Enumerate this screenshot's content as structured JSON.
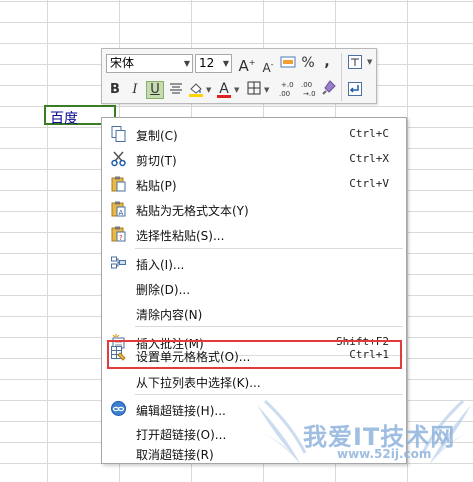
{
  "cell": {
    "value": "百度"
  },
  "mini_toolbar": {
    "font_name": "宋体",
    "font_size": "12",
    "grow_font": "A",
    "shrink_font": "A",
    "percent": "%",
    "comma": "،",
    "bold": "B",
    "italic": "I",
    "underline": "U",
    "font_color_letter": "A",
    "decimal_increase": ".0 .00",
    "decimal_decrease": ".00 .0",
    "font_color": "#e02020",
    "fill_color": "#ffd400"
  },
  "context_menu": {
    "items": [
      {
        "label": "复制(C)",
        "shortcut": "Ctrl+C",
        "icon": "copy-icon"
      },
      {
        "label": "剪切(T)",
        "shortcut": "Ctrl+X",
        "icon": "scissors-icon"
      },
      {
        "label": "粘贴(P)",
        "shortcut": "Ctrl+V",
        "icon": "paste-icon"
      },
      {
        "label": "粘贴为无格式文本(Y)",
        "shortcut": "",
        "icon": "paste-text-icon"
      },
      {
        "label": "选择性粘贴(S)...",
        "shortcut": "",
        "icon": "paste-special-icon"
      },
      {
        "label": "插入(I)...",
        "shortcut": "",
        "icon": "insert-icon"
      },
      {
        "label": "删除(D)...",
        "shortcut": "",
        "icon": ""
      },
      {
        "label": "清除内容(N)",
        "shortcut": "",
        "icon": ""
      },
      {
        "label": "插入批注(M)",
        "shortcut": "Shift+F2",
        "icon": "comment-icon"
      },
      {
        "label": "设置单元格格式(O)...",
        "shortcut": "Ctrl+1",
        "icon": "format-cells-icon"
      },
      {
        "label": "从下拉列表中选择(K)...",
        "shortcut": "",
        "icon": ""
      },
      {
        "label": "编辑超链接(H)...",
        "shortcut": "",
        "icon": "hyperlink-icon"
      },
      {
        "label": "打开超链接(O)...",
        "shortcut": "",
        "icon": ""
      },
      {
        "label": "取消超链接(R)",
        "shortcut": "",
        "icon": ""
      }
    ]
  },
  "watermark": {
    "text": "我爱IT技术网",
    "url": "www.52ij.com"
  },
  "colors": {
    "highlight": "#e23b3b",
    "cell_border": "#3b7d23",
    "toolbar_pressed": "#c4dcb0"
  }
}
